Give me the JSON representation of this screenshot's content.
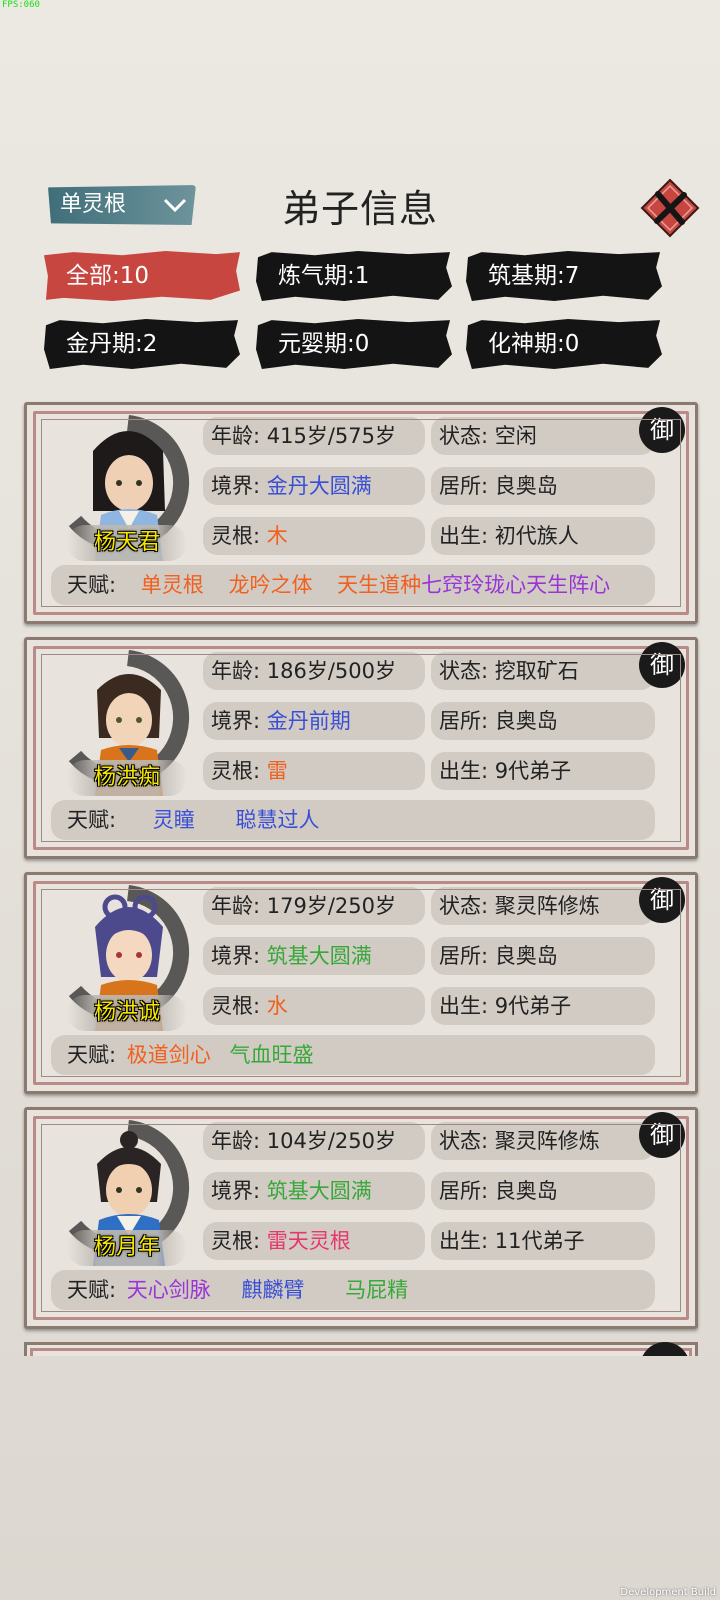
{
  "fps_label": "FPS:060",
  "dev_build": "Development Build",
  "header": {
    "filter_value": "单灵根",
    "title": "弟子信息"
  },
  "tabs": [
    {
      "label": "全部:10",
      "active": true
    },
    {
      "label": "炼气期:1"
    },
    {
      "label": "筑基期:7"
    },
    {
      "label": "金丹期:2"
    },
    {
      "label": "元婴期:0"
    },
    {
      "label": "化神期:0"
    }
  ],
  "badge_char": "御",
  "field_labels": {
    "age": "年龄:",
    "status": "状态:",
    "realm": "境界:",
    "residence": "居所:",
    "root": "灵根:",
    "birth": "出生:",
    "talent": "天赋:"
  },
  "disciples": [
    {
      "name": "杨天君",
      "age": "415岁/575岁",
      "status": "空闲",
      "realm": "金丹大圆满",
      "realm_color": "#3a4fd6",
      "residence": "良奥岛",
      "root": "木",
      "root_color": "#f0601e",
      "birth": "初代族人",
      "talents": [
        {
          "text": "单灵根",
          "color": "#f0601e"
        },
        {
          "text": "龙吟之体",
          "color": "#f0601e"
        },
        {
          "text": "天生道种",
          "color": "#f0601e"
        },
        {
          "text": "七窍玲珑心",
          "color": "#9a34d8"
        },
        {
          "text": "天生阵心",
          "color": "#9a34d8"
        }
      ]
    },
    {
      "name": "杨洪痴",
      "age": "186岁/500岁",
      "status": "挖取矿石",
      "realm": "金丹前期",
      "realm_color": "#3a4fd6",
      "residence": "良奥岛",
      "root": "雷",
      "root_color": "#f0601e",
      "birth": "9代弟子",
      "talents": [
        {
          "text": "灵瞳",
          "color": "#3a4fd6"
        },
        {
          "text": "聪慧过人",
          "color": "#3a4fd6"
        }
      ]
    },
    {
      "name": "杨洪诚",
      "age": "179岁/250岁",
      "status": "聚灵阵修炼",
      "realm": "筑基大圆满",
      "realm_color": "#38a83a",
      "residence": "良奥岛",
      "root": "水",
      "root_color": "#f0601e",
      "birth": "9代弟子",
      "talents": [
        {
          "text": "极道剑心",
          "color": "#f0601e"
        },
        {
          "text": "气血旺盛",
          "color": "#38a83a"
        }
      ]
    },
    {
      "name": "杨月年",
      "age": "104岁/250岁",
      "status": "聚灵阵修炼",
      "realm": "筑基大圆满",
      "realm_color": "#38a83a",
      "residence": "良奥岛",
      "root": "雷天灵根",
      "root_color": "#e8366e",
      "birth": "11代弟子",
      "talents": [
        {
          "text": "天心剑脉",
          "color": "#9a34d8"
        },
        {
          "text": "麒麟臂",
          "color": "#3a4fd6"
        },
        {
          "text": "马屁精",
          "color": "#38a83a"
        }
      ]
    }
  ],
  "colors": {
    "accent_red": "#c84640",
    "tab_dark": "#141414",
    "dropdown_teal": "#3f6e79",
    "name_yellow": "#f6e600"
  },
  "icons": [
    "chevron-down-icon",
    "close-icon",
    "seal-badge-icon",
    "portrait-avatar"
  ]
}
